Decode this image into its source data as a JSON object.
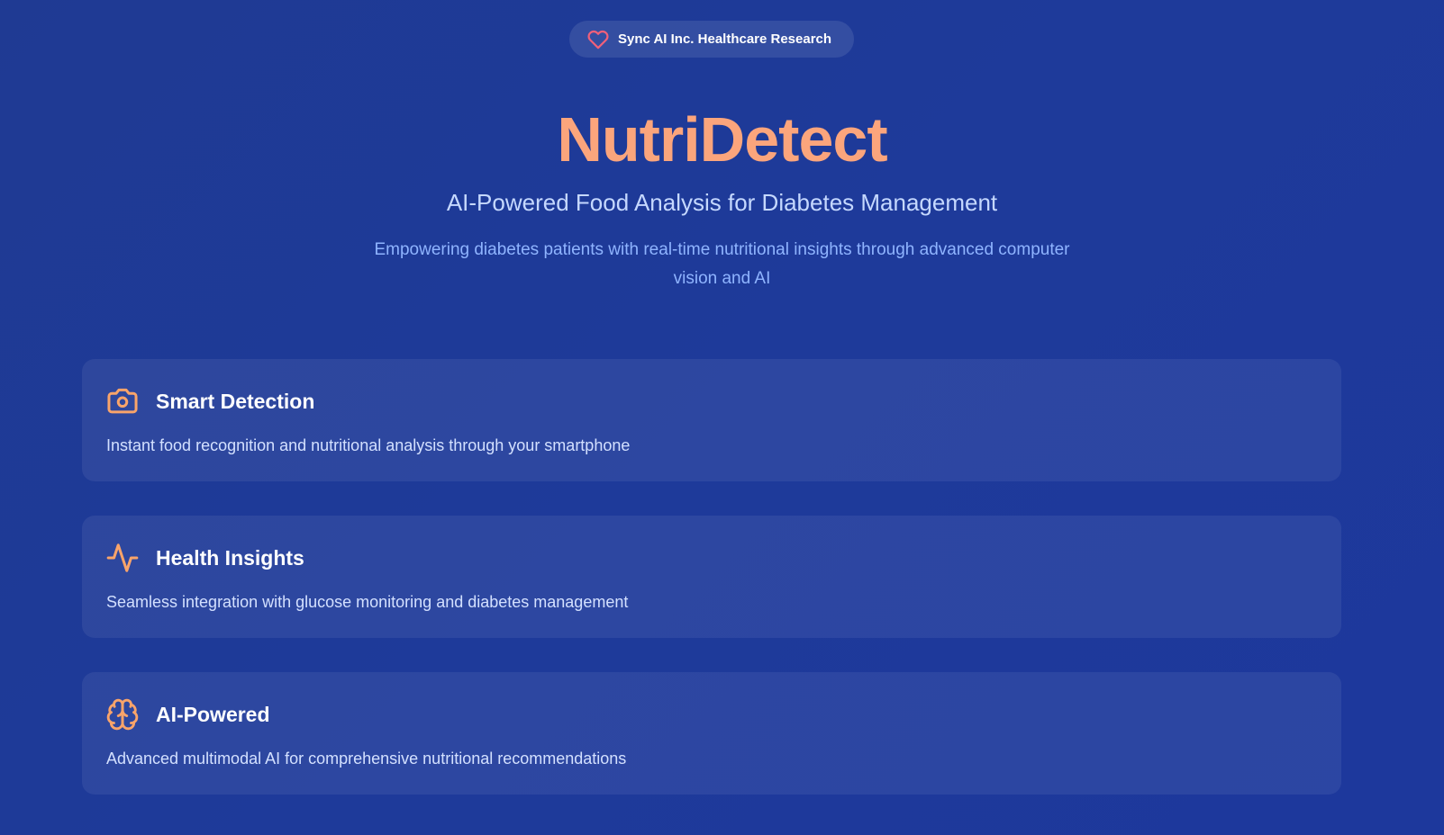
{
  "badge": {
    "icon": "heart-icon",
    "label": "Sync AI Inc. Healthcare Research"
  },
  "hero": {
    "title": "NutriDetect",
    "subtitle": "AI-Powered Food Analysis for Diabetes Management",
    "description": "Empowering diabetes patients with real-time nutritional insights through advanced computer vision and AI"
  },
  "features": [
    {
      "icon": "camera-icon",
      "title": "Smart Detection",
      "description": "Instant food recognition and nutritional analysis through your smartphone"
    },
    {
      "icon": "activity-icon",
      "title": "Health Insights",
      "description": "Seamless integration with glucose monitoring and diabetes management"
    },
    {
      "icon": "brain-icon",
      "title": "AI-Powered",
      "description": "Advanced multimodal AI for comprehensive nutritional recommendations"
    }
  ],
  "colors": {
    "accent": "#fba57c",
    "icon_accent": "#f9a46a",
    "heart": "#f0607a",
    "background": "#1e3a9a"
  }
}
